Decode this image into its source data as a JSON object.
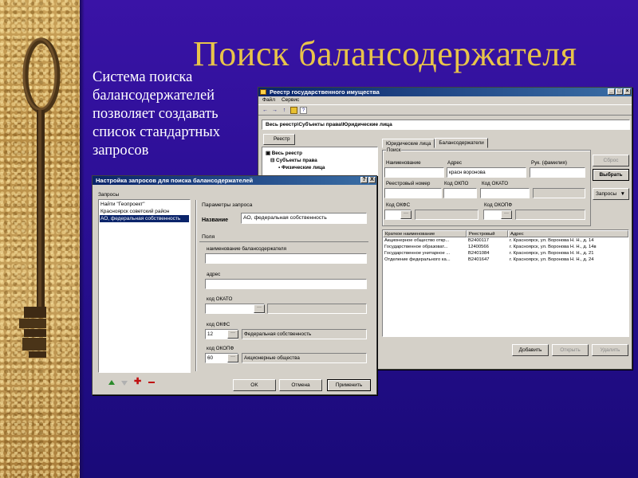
{
  "slide": {
    "title": "Поиск балансодержателя",
    "description": "Система поиска балансодержателей позволяет создавать список стандартных запросов"
  },
  "main_window": {
    "title": "Реестр государственного имущества",
    "menu": [
      "Файл",
      "Сервис"
    ],
    "toolbar": [
      "back-arrow-icon",
      "forward-arrow-icon",
      "up-arrow-icon",
      "folder-icon",
      "help-icon"
    ],
    "path": "Весь реестр\\Субъекты права\\Юридические лица",
    "tree_button": "Реестр",
    "tree": [
      {
        "label": "Весь реестр",
        "bold": true,
        "indent": 0
      },
      {
        "label": "Субъекты права",
        "bold": true,
        "indent": 1
      },
      {
        "label": "Физические лица",
        "bold": true,
        "indent": 2
      }
    ],
    "tabs": [
      "Юридические лица",
      "Балансодержатели"
    ],
    "search_group_label": "Поиск",
    "fields": {
      "name_label": "Наименование",
      "name_value": "",
      "address_label": "Адрес",
      "address_value": "красн воронова",
      "head_label": "Рук. (фамилия)",
      "head_value": "",
      "reg_num_label": "Реестровый номер",
      "reg_num_value": "",
      "okpo_label": "Код ОКПО",
      "okpo_value": "",
      "okato_label": "Код ОКАТО",
      "okato_value": "",
      "okfs_label": "Код ОКФС",
      "okfs_value": "",
      "okopf_label": "Код ОКОПФ",
      "okopf_value": ""
    },
    "buttons": {
      "reset": "Сброс",
      "select": "Выбрать",
      "requests": "Запросы"
    },
    "grid": {
      "columns": [
        "Краткое наименование",
        "Реестровый",
        "Адрес"
      ],
      "rows": [
        [
          "Акционерное общество откр...",
          "В2400117",
          "г. Красноярск, ул. Воронова Н. Н., д. 14"
        ],
        [
          "Государственное образоват...",
          "12400566",
          "г. Красноярск, ул. Воронова Н. Н., д. 14в"
        ],
        [
          "Государственное унитарное ...",
          "В2401084",
          "г. Красноярск, ул. Воронова Н. Н., д. 21"
        ],
        [
          "Отделение федерального ка...",
          "В2401647",
          "г. Красноярск, ул. Воронова Н. Н., д. 24"
        ]
      ]
    },
    "bottom_buttons": {
      "add": "Добавить",
      "open": "Открыть",
      "delete": "Удалить"
    }
  },
  "dialog": {
    "title": "Настройка запросов для поиска балансодержателей",
    "title_buttons": [
      "?",
      "X"
    ],
    "requests_label": "Запросы",
    "requests": [
      {
        "label": "Найти \"Геопроект\"",
        "selected": false
      },
      {
        "label": "Красноярск советский район",
        "selected": false
      },
      {
        "label": "АО, федеральная собственность",
        "selected": true
      }
    ],
    "params_label": "Параметры запроса",
    "name_label": "Название",
    "name_value": "АО, федеральная собственность",
    "fields_label": "Поля",
    "holder_name_label": "наименование балансодержателя",
    "holder_name_value": "",
    "address_label": "адрес",
    "address_value": "",
    "okato_label": "код ОКАТО",
    "okato_value": "",
    "okato_desc": "",
    "okfs_label": "код ОКФС",
    "okfs_value": "12",
    "okfs_desc": "Федеральная собственность",
    "okopf_label": "код ОКОПФ",
    "okopf_value": "60",
    "okopf_desc": "Акционерные общества",
    "buttons": {
      "ok": "OK",
      "cancel": "Отмена",
      "apply": "Применить"
    },
    "list_tools": [
      "up-arrow-icon",
      "down-arrow-icon",
      "add-icon",
      "remove-icon"
    ]
  },
  "colors": {
    "background": "#2a0f94",
    "title": "#e8c44a",
    "titlebar_start": "#0a246a",
    "titlebar_end": "#3a6ea5",
    "window_face": "#d4d0c8"
  }
}
